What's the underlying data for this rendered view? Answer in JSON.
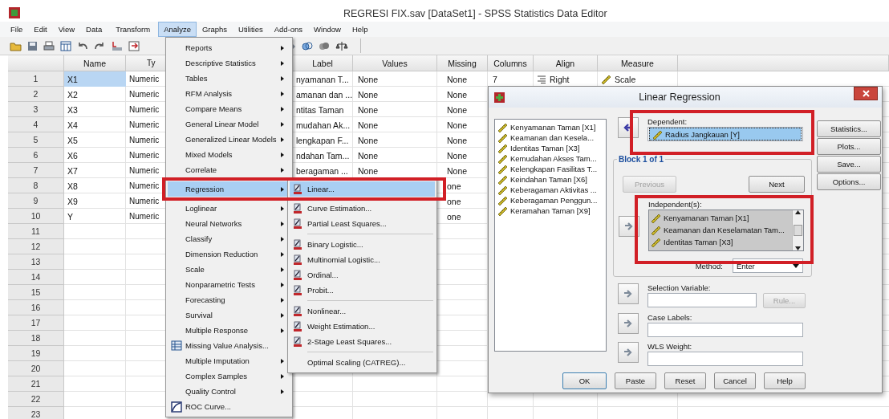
{
  "window": {
    "title": "REGRESI FIX.sav [DataSet1] - SPSS Statistics Data Editor"
  },
  "menu_bar": [
    {
      "label": "File",
      "selected": false
    },
    {
      "label": "Edit",
      "selected": false
    },
    {
      "label": "View",
      "selected": false
    },
    {
      "label": "Data",
      "selected": false
    },
    {
      "label": "Transform",
      "selected": false
    },
    {
      "label": "Analyze",
      "selected": true
    },
    {
      "label": "Graphs",
      "selected": false
    },
    {
      "label": "Utilities",
      "selected": false
    },
    {
      "label": "Add-ons",
      "selected": false
    },
    {
      "label": "Window",
      "selected": false
    },
    {
      "label": "Help",
      "selected": false
    }
  ],
  "grid": {
    "columns": [
      "Name",
      "Ty",
      "Label",
      "Values",
      "Missing",
      "Columns",
      "Align",
      "Measure"
    ],
    "rows": [
      {
        "number": "1",
        "name": "X1",
        "type": "Numeric",
        "label": "nyamanan T...",
        "values": "None",
        "missing": "None",
        "columns": "7",
        "align": "Right",
        "measure": "Scale",
        "selected": true
      },
      {
        "number": "2",
        "name": "X2",
        "type": "Numeric",
        "label": "amanan dan ...",
        "values": "None",
        "missing": "None",
        "selected": false
      },
      {
        "number": "3",
        "name": "X3",
        "type": "Numeric",
        "label": "ntitas Taman",
        "values": "None",
        "missing": "None",
        "selected": false
      },
      {
        "number": "4",
        "name": "X4",
        "type": "Numeric",
        "label": "mudahan Ak...",
        "values": "None",
        "missing": "None",
        "selected": false
      },
      {
        "number": "5",
        "name": "X5",
        "type": "Numeric",
        "label": "lengkapan F...",
        "values": "None",
        "missing": "None",
        "selected": false
      },
      {
        "number": "6",
        "name": "X6",
        "type": "Numeric",
        "label": "ndahan Tam...",
        "values": "None",
        "missing": "None",
        "selected": false
      },
      {
        "number": "7",
        "name": "X7",
        "type": "Numeric",
        "label": "beragaman ...",
        "values": "None",
        "missing": "None",
        "selected": false
      },
      {
        "number": "8",
        "name": "X8",
        "type": "Numeric",
        "missing": "one",
        "selected": false
      },
      {
        "number": "9",
        "name": "X9",
        "type": "Numeric",
        "missing": "one",
        "selected": false
      },
      {
        "number": "10",
        "name": "Y",
        "type": "Numeric",
        "missing": "one",
        "selected": false
      },
      {
        "number": "11",
        "selected": false
      },
      {
        "number": "12",
        "selected": false
      },
      {
        "number": "13",
        "selected": false
      },
      {
        "number": "14",
        "selected": false
      },
      {
        "number": "15",
        "selected": false
      },
      {
        "number": "16",
        "selected": false
      },
      {
        "number": "17",
        "selected": false
      },
      {
        "number": "18",
        "selected": false
      },
      {
        "number": "19",
        "selected": false
      },
      {
        "number": "20",
        "selected": false
      },
      {
        "number": "21",
        "selected": false
      },
      {
        "number": "22",
        "selected": false
      },
      {
        "number": "23",
        "selected": false
      }
    ]
  },
  "analyze_menu": [
    {
      "label": "Reports",
      "kind": "submenu",
      "selected": false,
      "framed": false
    },
    {
      "label": "Descriptive Statistics",
      "kind": "submenu",
      "selected": false,
      "framed": false
    },
    {
      "label": "Tables",
      "kind": "submenu",
      "selected": false,
      "framed": false
    },
    {
      "label": "RFM Analysis",
      "kind": "submenu",
      "selected": false,
      "framed": false
    },
    {
      "label": "Compare Means",
      "kind": "submenu",
      "selected": false,
      "framed": false
    },
    {
      "label": "General Linear Model",
      "kind": "submenu",
      "selected": false,
      "framed": false
    },
    {
      "label": "Generalized Linear Models",
      "kind": "submenu",
      "selected": false,
      "framed": false
    },
    {
      "label": "Mixed Models",
      "kind": "submenu",
      "selected": false,
      "framed": false
    },
    {
      "label": "Correlate",
      "kind": "submenu",
      "selected": false,
      "framed": false
    },
    {
      "label": "Regression",
      "kind": "submenu",
      "selected": true,
      "framed": true
    },
    {
      "label": "Loglinear",
      "kind": "submenu",
      "selected": false,
      "framed": false
    },
    {
      "label": "Neural Networks",
      "kind": "submenu",
      "selected": false,
      "framed": false
    },
    {
      "label": "Classify",
      "kind": "submenu",
      "selected": false,
      "framed": false
    },
    {
      "label": "Dimension Reduction",
      "kind": "submenu",
      "selected": false,
      "framed": false
    },
    {
      "label": "Scale",
      "kind": "submenu",
      "selected": false,
      "framed": false
    },
    {
      "label": "Nonparametric Tests",
      "kind": "submenu",
      "selected": false,
      "framed": false
    },
    {
      "label": "Forecasting",
      "kind": "submenu",
      "selected": false,
      "framed": false
    },
    {
      "label": "Survival",
      "kind": "submenu",
      "selected": false,
      "framed": false
    },
    {
      "label": "Multiple Response",
      "kind": "submenu",
      "selected": false,
      "framed": false
    },
    {
      "label": "Missing Value Analysis...",
      "kind": "command",
      "selected": false,
      "framed": false
    },
    {
      "label": "Multiple Imputation",
      "kind": "submenu",
      "selected": false,
      "framed": false
    },
    {
      "label": "Complex Samples",
      "kind": "submenu",
      "selected": false,
      "framed": false
    },
    {
      "label": "Quality Control",
      "kind": "submenu",
      "selected": false,
      "framed": false
    },
    {
      "label": "ROC Curve...",
      "kind": "command",
      "selected": false,
      "framed": false
    }
  ],
  "regression_menu": [
    {
      "label": "Linear...",
      "kind": "command",
      "selected": true
    },
    {
      "label": "Curve Estimation...",
      "kind": "command",
      "selected": false
    },
    {
      "label": "Partial Least Squares...",
      "kind": "command",
      "selected": false
    },
    {
      "kind": "separator"
    },
    {
      "label": "Binary Logistic...",
      "kind": "command",
      "selected": false
    },
    {
      "label": "Multinomial Logistic...",
      "kind": "command",
      "selected": false
    },
    {
      "label": "Ordinal...",
      "kind": "command",
      "selected": false
    },
    {
      "label": "Probit...",
      "kind": "command",
      "selected": false
    },
    {
      "kind": "separator"
    },
    {
      "label": "Nonlinear...",
      "kind": "command",
      "selected": false
    },
    {
      "label": "Weight Estimation...",
      "kind": "command",
      "selected": false
    },
    {
      "label": "2-Stage Least Squares...",
      "kind": "command",
      "selected": false
    },
    {
      "kind": "separator"
    },
    {
      "label": "Optimal Scaling (CATREG)...",
      "kind": "plain",
      "selected": false
    }
  ],
  "dialog": {
    "title": "Linear Regression",
    "variables": [
      "Kenyamanan Taman [X1]",
      "Keamanan dan Kesela...",
      "Identitas Taman [X3]",
      "Kemudahan Akses Tam...",
      "Kelengkapan Fasilitas T...",
      "Keindahan Taman [X6]",
      "Keberagaman Aktivitas ...",
      "Keberagaman Penggun...",
      "Keramahan Taman [X9]"
    ],
    "dependent": {
      "label": "Dependent:",
      "value": "Radius Jangkauan [Y]",
      "framed": true
    },
    "block": {
      "label": "Block 1 of 1",
      "previous": {
        "label": "Previous",
        "disabled": true
      },
      "next": {
        "label": "Next",
        "disabled": false
      }
    },
    "independents": {
      "label": "Independent(s):",
      "items": [
        "Kenyamanan Taman [X1]",
        "Keamanan dan Keselamatan Tam...",
        "Identitas Taman [X3]"
      ],
      "framed": true
    },
    "method": {
      "label": "Method:",
      "value": "Enter"
    },
    "selection_variable": {
      "label": "Selection Variable:",
      "rule": {
        "label": "Rule...",
        "disabled": true
      }
    },
    "case_labels": {
      "label": "Case Labels:"
    },
    "wls_weight": {
      "label": "WLS Weight:"
    },
    "side_buttons": [
      "Statistics...",
      "Plots...",
      "Save...",
      "Options..."
    ],
    "buttons": [
      "OK",
      "Paste",
      "Reset",
      "Cancel",
      "Help"
    ]
  }
}
